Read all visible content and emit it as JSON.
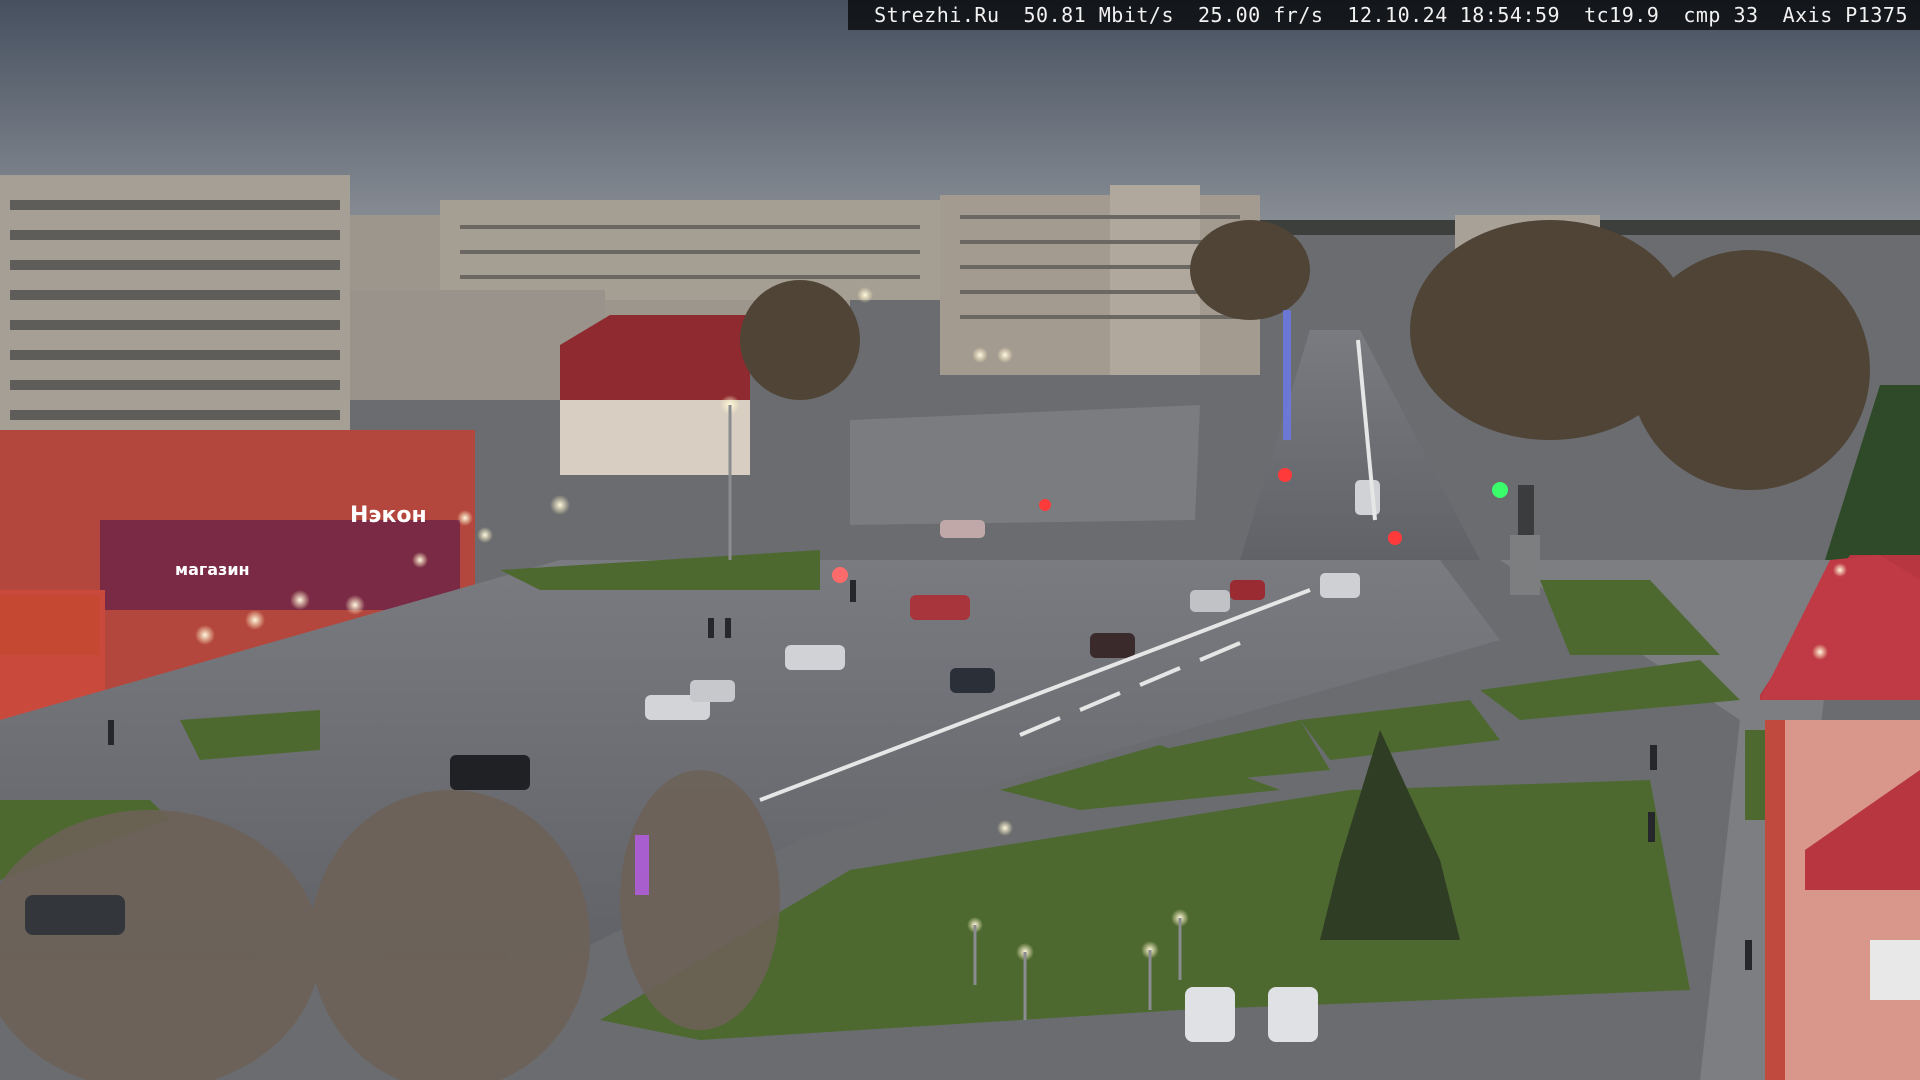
{
  "overlay": {
    "site": "Strezhi.Ru",
    "bitrate": "50.81 Mbit/s",
    "framerate": "25.00 fr/s",
    "date": "12.10.24",
    "time": "18:54:59",
    "tc": "tc19.9",
    "cmp": "cmp 33",
    "camera": "Axis P1375"
  },
  "signs": {
    "store_left": "Нэкон",
    "store_sign_small": "магазин"
  },
  "colors": {
    "sky": "#4f5a6b",
    "sky_horizon": "#8a9098",
    "road": "#6e7077",
    "grass": "#4e6a32",
    "building_red": "#b5463c",
    "building_gray": "#9a9590"
  }
}
